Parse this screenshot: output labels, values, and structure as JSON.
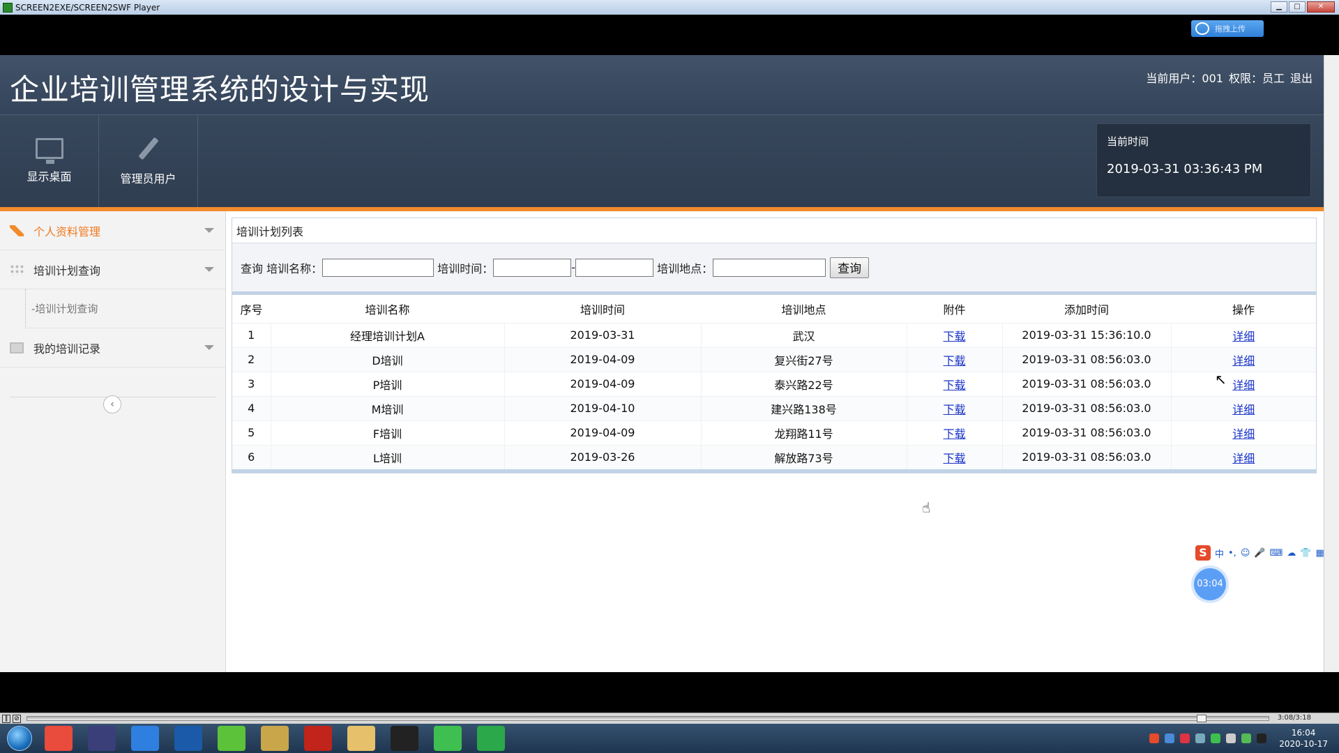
{
  "window": {
    "title": "SCREEN2EXE/SCREEN2SWF Player",
    "upload_label": "拖拽上传"
  },
  "header": {
    "app_title": "企业培训管理系统的设计与实现",
    "user_label": "当前用户：001",
    "role_label": "权限：员工",
    "logout_label": "退出",
    "tiles": [
      {
        "label": "显示桌面",
        "icon": "monitor-icon"
      },
      {
        "label": "管理员用户",
        "icon": "pencil-icon"
      }
    ],
    "time_label": "当前时间",
    "time_value": "2019-03-31 03:36:43 PM"
  },
  "sidebar": {
    "items": [
      {
        "label": "个人资料管理",
        "icon": "pencil-icon",
        "active": true
      },
      {
        "label": "培训计划查询",
        "icon": "grid-icon"
      },
      {
        "label": "-培训计划查询",
        "sub": true
      },
      {
        "label": "我的培训记录",
        "icon": "book-icon"
      }
    ],
    "collapse_glyph": "‹"
  },
  "panel": {
    "title": "培训计划列表",
    "search": {
      "prefix": "查询",
      "name_label": "培训名称：",
      "time_label": "培训时间：",
      "time_sep": "-",
      "place_label": "培训地点：",
      "button": "查询",
      "name_value": "",
      "time_from": "",
      "time_to": "",
      "place_value": ""
    },
    "columns": [
      "序号",
      "培训名称",
      "培训时间",
      "培训地点",
      "附件",
      "添加时间",
      "操作"
    ],
    "rows": [
      [
        "1",
        "经理培训计划A",
        "2019-03-31",
        "武汉",
        "下载",
        "2019-03-31 15:36:10.0",
        "详细"
      ],
      [
        "2",
        "D培训",
        "2019-04-09",
        "复兴街27号",
        "下载",
        "2019-03-31 08:56:03.0",
        "详细"
      ],
      [
        "3",
        "P培训",
        "2019-04-09",
        "泰兴路22号",
        "下载",
        "2019-03-31 08:56:03.0",
        "详细"
      ],
      [
        "4",
        "M培训",
        "2019-04-10",
        "建兴路138号",
        "下载",
        "2019-03-31 08:56:03.0",
        "详细"
      ],
      [
        "5",
        "F培训",
        "2019-04-09",
        "龙翔路11号",
        "下载",
        "2019-03-31 08:56:03.0",
        "详细"
      ],
      [
        "6",
        "L培训",
        "2019-03-26",
        "解放路73号",
        "下载",
        "2019-03-31 08:56:03.0",
        "详细"
      ]
    ]
  },
  "overlay": {
    "ime": [
      "中",
      "•,",
      "☺",
      "🎤",
      "⌨",
      "☁",
      "👕",
      "▦"
    ],
    "timer": "03:04"
  },
  "player": {
    "time": "3:08/3:18"
  },
  "taskbar": {
    "clock_time": "16:04",
    "clock_date": "2020-10-17",
    "apps": [
      "chrome-icon",
      "eclipse-icon",
      "baidu-netdisk-icon",
      "browser-icon",
      "leaf-icon",
      "notepad-icon",
      "flash-icon",
      "folder-icon",
      "qq-icon",
      "wechat-icon",
      "player-icon"
    ],
    "app_colors": [
      "#e94b3c",
      "#3a3f7a",
      "#2f7fe0",
      "#1a5aa8",
      "#5cc23a",
      "#c9a64a",
      "#c0241b",
      "#e6c06a",
      "#222222",
      "#3fbf4f",
      "#2aa84a"
    ]
  }
}
